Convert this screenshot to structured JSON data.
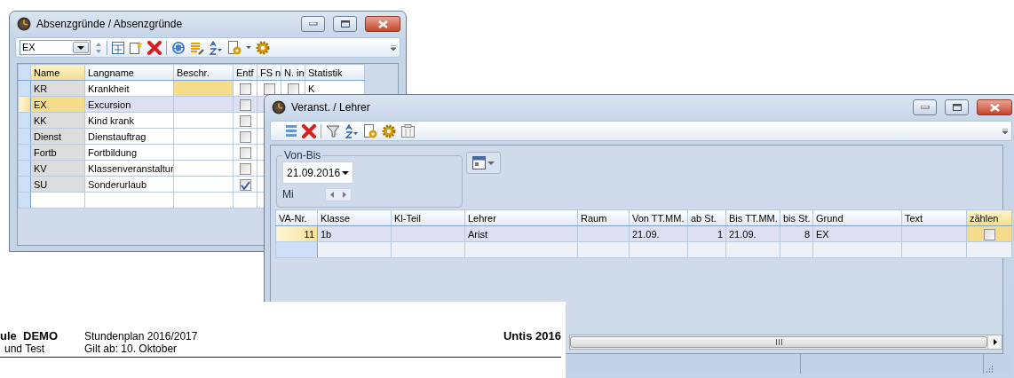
{
  "absence_window": {
    "title": "Absenzgründe / Absenzgründe",
    "combo_value": "EX",
    "columns": [
      {
        "label": "Name",
        "current": true
      },
      {
        "label": "Langname",
        "current": false
      },
      {
        "label": "Beschr.",
        "current": false
      },
      {
        "label": "Entf",
        "current": false
      },
      {
        "label": "FS n",
        "current": false
      },
      {
        "label": "N. in",
        "current": false
      },
      {
        "label": "Statistik",
        "current": false
      }
    ],
    "rows": [
      {
        "name": "KR",
        "langname": "Krankheit",
        "entf": false,
        "fs": false,
        "n_in": false,
        "statistik": "K",
        "selected": false,
        "focused": true
      },
      {
        "name": "EX",
        "langname": "Excursion",
        "entf": false,
        "selected": true,
        "focused": false
      },
      {
        "name": "KK",
        "langname": "Kind krank",
        "entf": false,
        "selected": false,
        "focused": false
      },
      {
        "name": "Dienst",
        "langname": "Dienstauftrag",
        "entf": false,
        "selected": false,
        "focused": false
      },
      {
        "name": "Fortb",
        "langname": "Fortbildung",
        "entf": false,
        "selected": false,
        "focused": false
      },
      {
        "name": "KV",
        "langname": "Klassenveranstaltur",
        "entf": false,
        "selected": false,
        "focused": false
      },
      {
        "name": "SU",
        "langname": "Sonderurlaub",
        "entf": true,
        "selected": false,
        "focused": false
      }
    ]
  },
  "event_window": {
    "title": "Veranst. / Lehrer",
    "von_bis": {
      "label": "Von-Bis",
      "date": "21.09.2016",
      "weekday": "Mi"
    },
    "columns": [
      {
        "label": "VA-Nr.",
        "current": false
      },
      {
        "label": "Klasse",
        "current": false
      },
      {
        "label": "Kl-Teil",
        "current": false
      },
      {
        "label": "Lehrer",
        "current": false
      },
      {
        "label": "Raum",
        "current": false
      },
      {
        "label": "Von TT.MM.",
        "current": false
      },
      {
        "label": "ab St.",
        "current": false
      },
      {
        "label": "Bis TT.MM.",
        "current": false
      },
      {
        "label": "bis St.",
        "current": false
      },
      {
        "label": "Grund",
        "current": false
      },
      {
        "label": "Text",
        "current": false
      },
      {
        "label": "zählen",
        "current": true
      }
    ],
    "rows": [
      {
        "cells": [
          "11",
          "1b",
          "",
          "Arist",
          "",
          "21.09.",
          "1",
          "21.09.",
          "8",
          "EX",
          ""
        ],
        "zaehlen": false,
        "selected": true
      }
    ]
  },
  "document": {
    "school_name": "ule  DEMO",
    "school_subtitle": "und Test",
    "plan_title": "Stundenplan 2016/2017",
    "valid_from": "Gilt ab: 10. Oktober",
    "product": "Untis 2016"
  }
}
